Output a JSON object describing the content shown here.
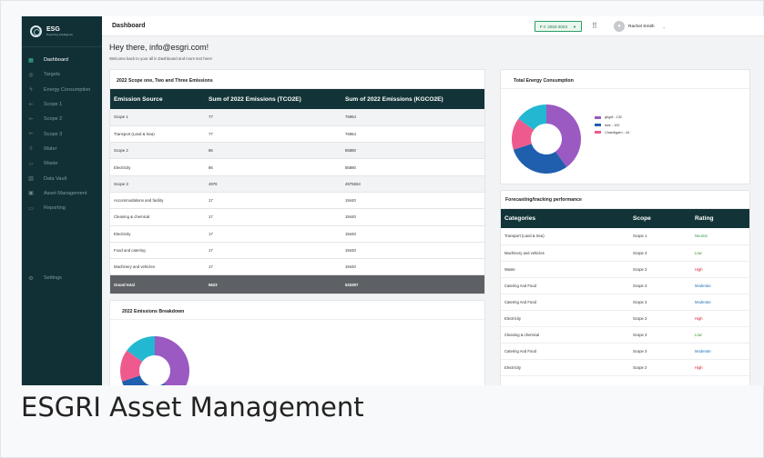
{
  "caption": "ESGRI Asset Management",
  "sidebar": {
    "brand": "ESG",
    "brand_sub": "Reporting Intelligence",
    "items": [
      {
        "label": "Dashboard",
        "icon": "grid-icon",
        "glyph": "▦"
      },
      {
        "label": "Targets",
        "icon": "target-icon",
        "glyph": "◎"
      },
      {
        "label": "Energy Consumption",
        "icon": "bolt-icon",
        "glyph": "ϟ"
      },
      {
        "label": "Scope 1",
        "icon": "flow-icon",
        "glyph": "⟜"
      },
      {
        "label": "Scope 2",
        "icon": "flow-icon",
        "glyph": "⟜"
      },
      {
        "label": "Scope 3",
        "icon": "flow-icon",
        "glyph": "⟜"
      },
      {
        "label": "Water",
        "icon": "drop-icon",
        "glyph": "◊"
      },
      {
        "label": "Waste",
        "icon": "recycle-icon",
        "glyph": "▱"
      },
      {
        "label": "Data Vault",
        "icon": "bar-chart-icon",
        "glyph": "▥"
      },
      {
        "label": "Asset Management",
        "icon": "clipboard-icon",
        "glyph": "▣"
      },
      {
        "label": "Reporting",
        "icon": "folder-icon",
        "glyph": "▭"
      }
    ],
    "settings": {
      "label": "Settings",
      "glyph": "⚙"
    }
  },
  "header": {
    "title": "Dashboard",
    "fy": "F.Y. 2022-2023",
    "user": "Rachel Smith"
  },
  "greeting": "Hey there, info@esgri.com!",
  "greeting_sub": "Welcome back to your all in Dashboard and more text here!",
  "emissions_card": {
    "title": "2022 Scope one, Two and Three Emissions",
    "headers": [
      "Emission Source",
      "Sum of 2022 Emissions (TCO2E)",
      "Sum of 2022 Emissions (KGCO2E)"
    ],
    "rows": [
      [
        "Scope 1",
        "77",
        "76964"
      ],
      [
        "Transport (Land & Sea)",
        "77",
        "76964"
      ],
      [
        "Scope 2",
        "86",
        "85880"
      ],
      [
        "Electricity",
        "86",
        "85880"
      ],
      [
        "Scope 3",
        "4976",
        "4975553"
      ],
      [
        "Accommodations and facility",
        "17",
        "19440"
      ],
      [
        "Cleaning & chemical",
        "17",
        "19440"
      ],
      [
        "Electricity",
        "17",
        "19440"
      ],
      [
        "Food and catering",
        "17",
        "19440"
      ],
      [
        "Machinery and vehicles",
        "17",
        "19440"
      ]
    ],
    "total": [
      "Grand total",
      "5623",
      "533397"
    ]
  },
  "breakdown_card": {
    "title": "2022 Emissions Breakdown"
  },
  "energy_card": {
    "title": "Total Energy Consumption",
    "legend": [
      "ghgdl - 132",
      "kwe - 102",
      "Chandigarh - 44"
    ]
  },
  "forecast_card": {
    "title": "Forecasting/tracking performance",
    "headers": [
      "Categories",
      "Scope",
      "Rating"
    ],
    "rows": [
      [
        "Transport (Land & Sea)",
        "Scope 1",
        "Neutral"
      ],
      [
        "Machinery and vehicles",
        "Scope 3",
        "Low"
      ],
      [
        "Waste",
        "Scope 3",
        "High"
      ],
      [
        "Catering And Food",
        "Scope 3",
        "Moderate"
      ],
      [
        "Catering And Food",
        "Scope 3",
        "Moderate"
      ],
      [
        "Electricity",
        "Scope 2",
        "High"
      ],
      [
        "Cleaning & chemical",
        "Scope 3",
        "Low"
      ],
      [
        "Catering And Food",
        "Scope 3",
        "Moderate"
      ],
      [
        "Electricity",
        "Scope 2",
        "High"
      ]
    ]
  },
  "rating_colors": {
    "Neutral": "#2e9c4e",
    "Low": "#3a8f2a",
    "High": "#d0202a",
    "Moderate": "#1f6fb3"
  },
  "donut_colors": [
    "#9b59c2",
    "#1f5fae",
    "#ef5a8e",
    "#22b8d2"
  ]
}
